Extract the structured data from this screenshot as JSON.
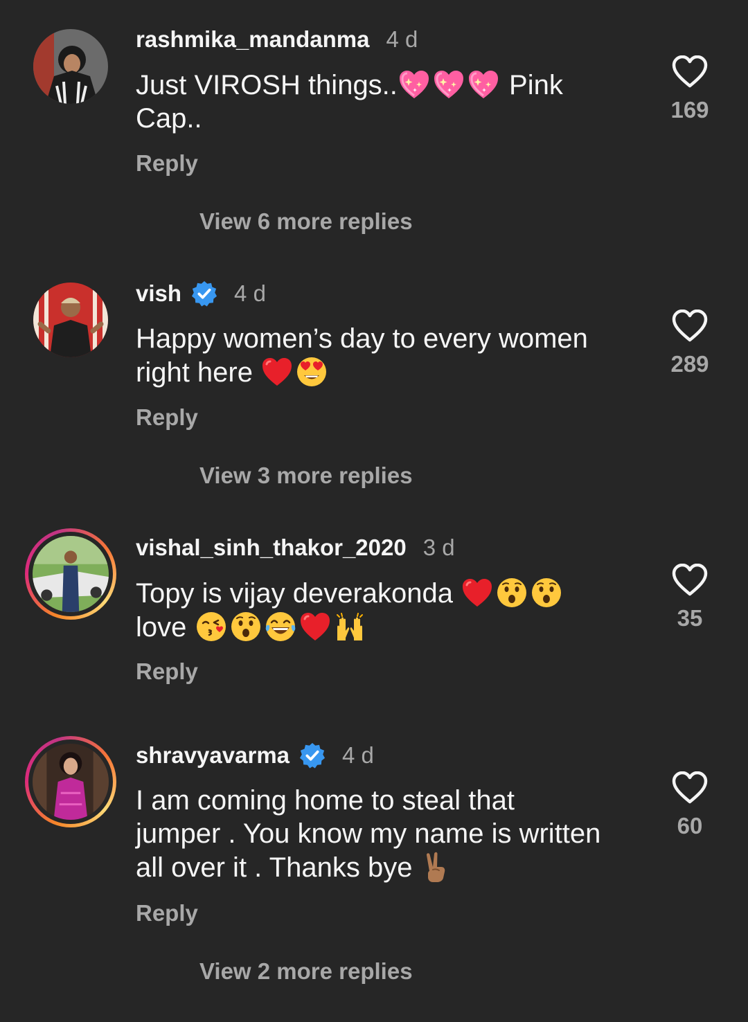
{
  "comments": [
    {
      "username": "rashmika_mandanma",
      "time": "4 d",
      "text_line1": "Just VIROSH things..",
      "text_after_emoji": " Pink",
      "text_line2": "Cap..",
      "emojis": [
        "sparkling-heart",
        "sparkling-heart",
        "sparkling-heart"
      ],
      "reply_label": "Reply",
      "likes": "169",
      "more_replies": "View 6 more replies"
    },
    {
      "username": "vish",
      "verified": true,
      "time": "4 d",
      "text_line1": "Happy women’s day to every women",
      "text_line2": "right here ",
      "emojis": [
        "red-heart",
        "heart-eyes-face"
      ],
      "reply_label": "Reply",
      "likes": "289",
      "more_replies": "View 3 more replies"
    },
    {
      "username": "vishal_sinh_thakor_2020",
      "time": "3 d",
      "text_line1": "Topy is vijay deverakonda ",
      "text_line2": "love ",
      "emojis_line1": [
        "red-heart",
        "hushed-face",
        "hushed-face"
      ],
      "emojis_line2": [
        "kissing-face",
        "hushed-face",
        "tears-of-joy-face",
        "red-heart",
        "raising-hands"
      ],
      "reply_label": "Reply",
      "likes": "35",
      "has_story_ring": true
    },
    {
      "username": "shravyavarma",
      "verified": true,
      "time": "4 d",
      "text_line1": "I am coming home to steal that",
      "text_line2": "jumper . You know my name is written",
      "text_line3": "all over it . Thanks bye ",
      "emojis": [
        "victory-hand"
      ],
      "reply_label": "Reply",
      "likes": "60",
      "more_replies": "View 2 more replies",
      "has_story_ring": true
    }
  ],
  "colors": {
    "background": "#262626",
    "primary_text": "#f5f5f5",
    "secondary_text": "#a8a8a8",
    "verified_blue": "#3897f0"
  }
}
